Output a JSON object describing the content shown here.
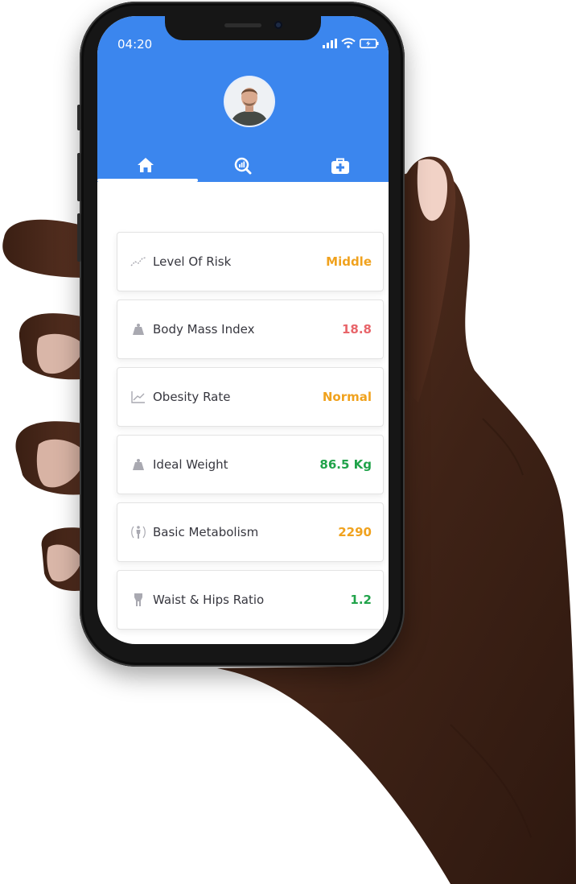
{
  "status_bar": {
    "time": "04:20"
  },
  "tabs": [
    {
      "id": "home",
      "icon": "home-icon",
      "active": true
    },
    {
      "id": "search",
      "icon": "search-chart-icon",
      "active": false
    },
    {
      "id": "medical",
      "icon": "first-aid-kit-icon",
      "active": false
    }
  ],
  "metrics": [
    {
      "icon": "trend-line-icon",
      "label": "Level Of Risk",
      "value": "Middle",
      "color": "#f0a21e"
    },
    {
      "icon": "weight-icon",
      "label": "Body Mass Index",
      "value": "18.8",
      "color": "#e8656a"
    },
    {
      "icon": "line-chart-icon",
      "label": "Obesity Rate",
      "value": "Normal",
      "color": "#f0a21e"
    },
    {
      "icon": "weight-icon",
      "label": "Ideal Weight",
      "value": "86.5 Kg",
      "color": "#20a34a"
    },
    {
      "icon": "person-icon",
      "label": "Basic Metabolism",
      "value": "2290",
      "color": "#f0a21e"
    },
    {
      "icon": "waist-icon",
      "label": "Waist & Hips Ratio",
      "value": "1.2",
      "color": "#20a34a"
    }
  ],
  "colors": {
    "header": "#3b86ee",
    "label": "#37373f",
    "icon": "#a9a9b1"
  }
}
